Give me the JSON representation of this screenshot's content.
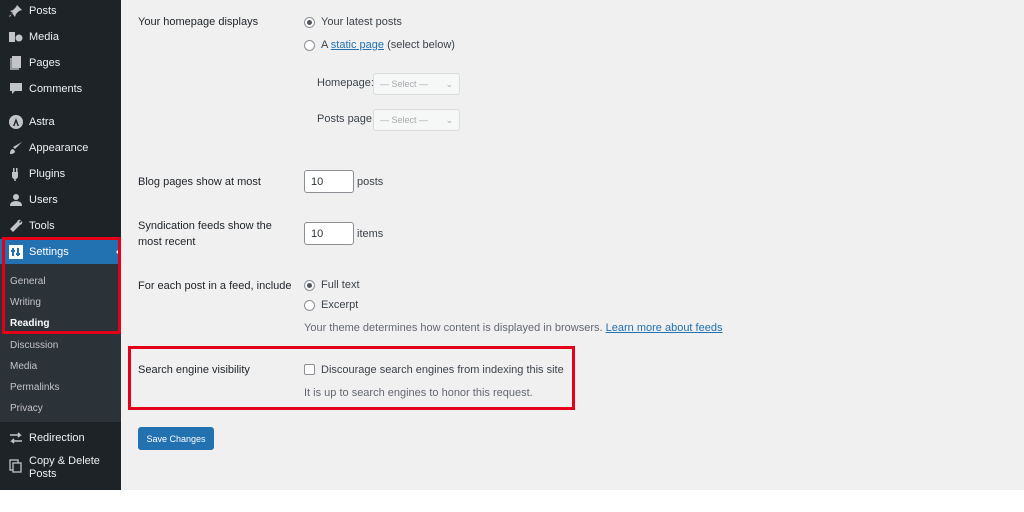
{
  "sidebar": {
    "items": [
      {
        "label": "Posts",
        "icon": "pin-icon"
      },
      {
        "label": "Media",
        "icon": "media-icon"
      },
      {
        "label": "Pages",
        "icon": "pages-icon"
      },
      {
        "label": "Comments",
        "icon": "comments-icon"
      },
      {
        "label": "Astra",
        "icon": "astra-icon"
      },
      {
        "label": "Appearance",
        "icon": "appearance-icon"
      },
      {
        "label": "Plugins",
        "icon": "plugins-icon"
      },
      {
        "label": "Users",
        "icon": "users-icon"
      },
      {
        "label": "Tools",
        "icon": "tools-icon"
      },
      {
        "label": "Settings",
        "icon": "settings-icon"
      },
      {
        "label": "Redirection",
        "icon": "redirection-icon"
      },
      {
        "label": "Copy & Delete Posts",
        "icon": "copy-delete-icon"
      }
    ],
    "settings_submenu": [
      "General",
      "Writing",
      "Reading",
      "Discussion",
      "Media",
      "Permalinks",
      "Privacy"
    ],
    "current_submenu": "Reading"
  },
  "form": {
    "homepage_displays": {
      "label": "Your homepage displays",
      "option_latest": "Your latest posts",
      "option_static_prefix": "A",
      "option_static_link": "static page",
      "option_static_suffix": "(select below)",
      "selected": "latest",
      "homepage_label": "Homepage:",
      "homepage_select": "— Select —",
      "posts_page_label": "Posts page:",
      "posts_page_select": "— Select —"
    },
    "blog_pages": {
      "label": "Blog pages show at most",
      "value": "10",
      "unit": "posts"
    },
    "syndication": {
      "label_line1": "Syndication feeds show the",
      "label_line2": "most recent",
      "value": "10",
      "unit": "items"
    },
    "feed_include": {
      "label": "For each post in a feed, include",
      "option_full": "Full text",
      "option_excerpt": "Excerpt",
      "selected": "full",
      "note_text": "Your theme determines how content is displayed in browsers.",
      "note_link": "Learn more about feeds"
    },
    "search_visibility": {
      "label": "Search engine visibility",
      "checkbox_label": "Discourage search engines from indexing this site",
      "checked": false,
      "description": "It is up to search engines to honor this request."
    },
    "save_label": "Save Changes"
  },
  "colors": {
    "sidebar": "#1d2327",
    "accent": "#2271b1",
    "highlight": "#e5001a"
  }
}
